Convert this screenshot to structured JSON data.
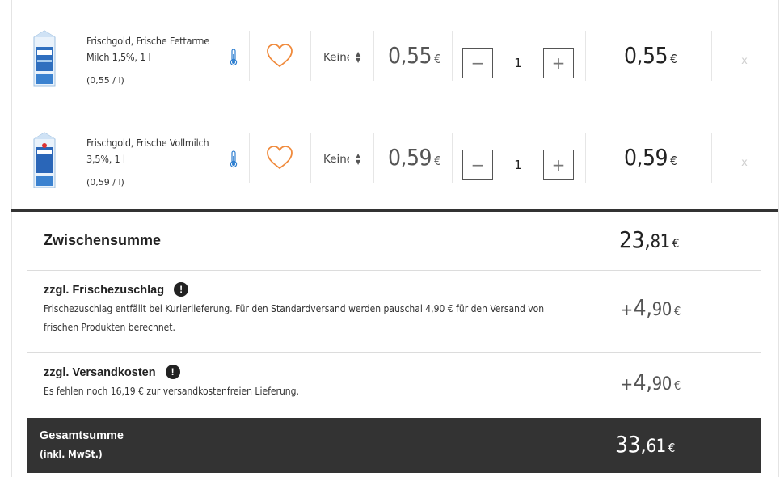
{
  "colors": {
    "heart": "#f08a3c",
    "thermometer": "#2f7fd0",
    "grand_bg": "#333333"
  },
  "items": [
    {
      "name": "Frischgold, Frische Fettarme Milch 1,5%, 1 l",
      "unit_price_text": "(0,55 / l)",
      "packaging": "Keine",
      "price_whole": "0,",
      "price_cents": "55",
      "quantity": "1",
      "total_whole": "0,",
      "total_cents": "55",
      "minus": "−",
      "plus": "+",
      "remove": "x",
      "thermometer_icon": "thermometer-icon",
      "favorite_icon": "heart-icon"
    },
    {
      "name": "Frischgold, Frische Vollmilch 3,5%, 1 l",
      "unit_price_text": "(0,59 / l)",
      "packaging": "Keine",
      "price_whole": "0,",
      "price_cents": "59",
      "quantity": "1",
      "total_whole": "0,",
      "total_cents": "59",
      "minus": "−",
      "plus": "+",
      "remove": "x",
      "thermometer_icon": "thermometer-icon",
      "favorite_icon": "heart-icon"
    }
  ],
  "currency": "€",
  "summary": {
    "subtotal_label": "Zwischensumme",
    "subtotal_whole": "23,",
    "subtotal_cents": "81",
    "fresh_fee_title": "zzgl. Frischezuschlag",
    "fresh_fee_desc": "Frischezuschlag entfällt bei Kurierlieferung. Für den Standardversand werden pauschal 4,90 € für den Versand von frischen Produkten berechnet.",
    "fresh_fee_plus": "+",
    "fresh_fee_whole": "4,",
    "fresh_fee_cents": "90",
    "shipping_title": "zzgl. Versandkosten",
    "shipping_desc": "Es fehlen noch 16,19 € zur versandkostenfreien Lieferung.",
    "shipping_plus": "+",
    "shipping_whole": "4,",
    "shipping_cents": "90",
    "info_badge": "!",
    "grand_label": "Gesamtsumme",
    "grand_sub": "(inkl. MwSt.)",
    "grand_whole": "33,",
    "grand_cents": "61"
  }
}
